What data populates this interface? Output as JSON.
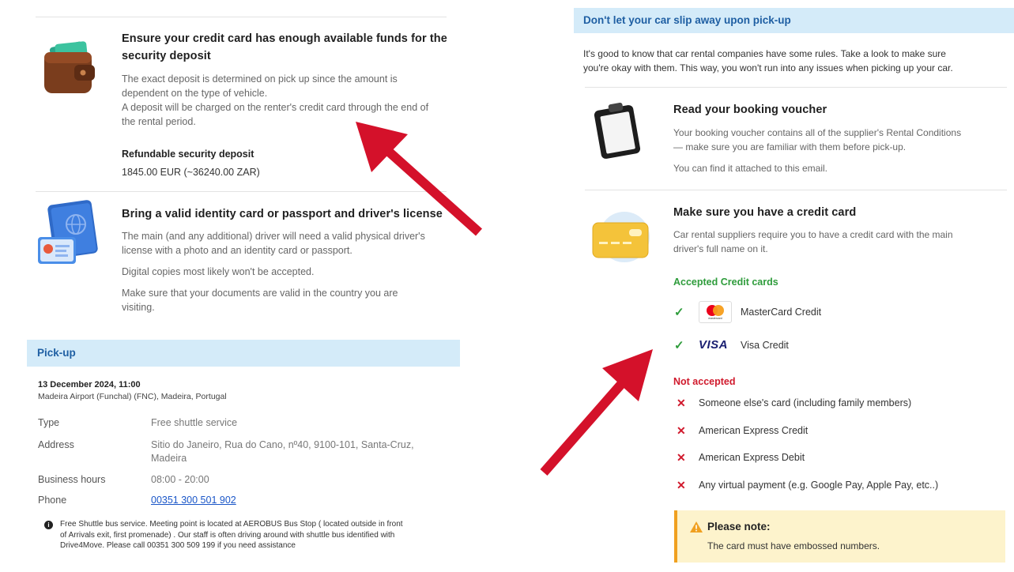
{
  "left": {
    "deposit": {
      "title_line1": "Ensure your credit card has enough available funds for the",
      "title_line2": "security deposit",
      "text1": "The exact deposit is determined on pick up since the amount is",
      "text2": "dependent on the type of vehicle.",
      "text3": "A deposit will be charged on the renter's credit card through the end of",
      "text4": "the rental period.",
      "deposit_label": "Refundable security deposit",
      "deposit_value": "1845.00 EUR (~36240.00 ZAR)"
    },
    "identity": {
      "title": "Bring a valid identity card or passport and driver's license",
      "text1": "The main (and any additional) driver will need a valid physical driver's",
      "text2": "license with a photo and an identity card or passport.",
      "text3": "Digital copies most likely won't be accepted.",
      "text4": "Make sure that your documents are valid in the country you are",
      "text5": "visiting."
    },
    "pickup": {
      "header": "Pick-up",
      "datetime": "13 December 2024, 11:00",
      "location": "Madeira Airport (Funchal) (FNC), Madeira, Portugal",
      "rows": {
        "type_label": "Type",
        "type_value": "Free shuttle service",
        "address_label": "Address",
        "address_value1": "Sitio do Janeiro, Rua do Cano, nº40, 9100-101, Santa-Cruz,",
        "address_value2": "Madeira",
        "hours_label": "Business hours",
        "hours_value": "08:00 - 20:00",
        "phone_label": "Phone",
        "phone_value": "00351 300 501 902"
      },
      "info_line1": "Free Shuttle bus service. Meeting point is located at AEROBUS Bus Stop ( located outside in front",
      "info_line2": "of Arrivals exit, first promenade) . Our staff is often driving around with shuttle bus identified with",
      "info_line3": "Drive4Move. Please call 00351 300 509 199 if you need assistance"
    }
  },
  "right": {
    "header": "Don't let your car slip away upon pick-up",
    "intro1": "It's good to know that car rental companies have some rules. Take a look to make sure",
    "intro2": "you're okay with them. This way, you won't run into any issues when picking up your car.",
    "voucher": {
      "title": "Read your booking voucher",
      "text1": "Your booking voucher contains all of the supplier's Rental Conditions",
      "text2": "— make sure you are familiar with them before pick-up.",
      "text3": "You can find it attached to this email."
    },
    "card": {
      "title": "Make sure you have a credit card",
      "text1": "Car rental suppliers require you to have a credit card with the main",
      "text2": "driver's full name on it.",
      "accepted_label": "Accepted Credit cards",
      "accepted": [
        "MasterCard Credit",
        "Visa Credit"
      ],
      "visa_logo": "VISA",
      "mc_logo_text": "mastercard",
      "not_accepted_label": "Not accepted",
      "not_accepted": [
        "Someone else's card (including family members)",
        "American Express Credit",
        "American Express Debit",
        "Any virtual payment (e.g. Google Pay, Apple Pay, etc..)"
      ]
    },
    "note": {
      "title": "Please note:",
      "text": "The card must have embossed numbers."
    }
  },
  "colors": {
    "section_bg": "#d4ebf9",
    "section_text": "#1f5fa3",
    "accepted_green": "#2e9c3b",
    "rejected_red": "#d0192c",
    "arrow_red": "#d4112a",
    "note_bg": "#fdf3cc"
  }
}
